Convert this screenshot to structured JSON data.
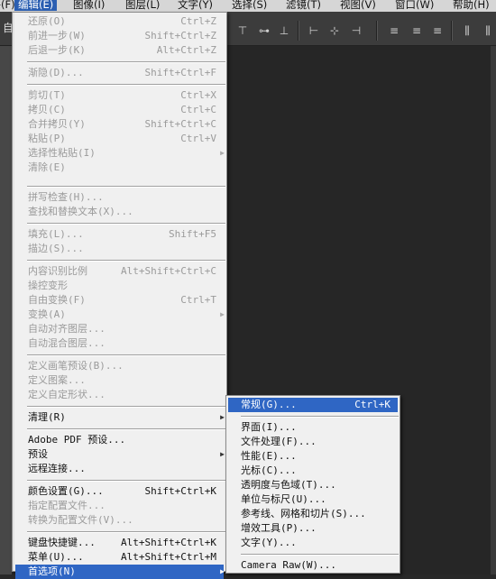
{
  "menubar": {
    "items": [
      "文件(F)",
      "编辑(E)",
      "图像(I)",
      "图层(L)",
      "文字(Y)",
      "选择(S)",
      "滤镜(T)",
      "视图(V)",
      "窗口(W)",
      "帮助(H)"
    ],
    "active_index": 1
  },
  "optbar": {
    "stub_label": "自"
  },
  "edit_menu": {
    "items": [
      {
        "label": "还原(O)",
        "shortcut": "Ctrl+Z",
        "enabled": false
      },
      {
        "label": "前进一步(W)",
        "shortcut": "Shift+Ctrl+Z",
        "enabled": false
      },
      {
        "label": "后退一步(K)",
        "shortcut": "Alt+Ctrl+Z",
        "enabled": false
      },
      {
        "label": "渐隐(D)...",
        "shortcut": "Shift+Ctrl+F",
        "enabled": false
      },
      {
        "label": "剪切(T)",
        "shortcut": "Ctrl+X",
        "enabled": false
      },
      {
        "label": "拷贝(C)",
        "shortcut": "Ctrl+C",
        "enabled": false
      },
      {
        "label": "合并拷贝(Y)",
        "shortcut": "Shift+Ctrl+C",
        "enabled": false
      },
      {
        "label": "粘贴(P)",
        "shortcut": "Ctrl+V",
        "enabled": false
      },
      {
        "label": "选择性粘贴(I)",
        "shortcut": "",
        "enabled": false,
        "submenu": true
      },
      {
        "label": "清除(E)",
        "shortcut": "",
        "enabled": false
      },
      {
        "label": "拼写检查(H)...",
        "shortcut": "",
        "enabled": false
      },
      {
        "label": "查找和替换文本(X)...",
        "shortcut": "",
        "enabled": false
      },
      {
        "label": "填充(L)...",
        "shortcut": "Shift+F5",
        "enabled": false
      },
      {
        "label": "描边(S)...",
        "shortcut": "",
        "enabled": false
      },
      {
        "label": "内容识别比例",
        "shortcut": "Alt+Shift+Ctrl+C",
        "enabled": false
      },
      {
        "label": "操控变形",
        "shortcut": "",
        "enabled": false
      },
      {
        "label": "自由变换(F)",
        "shortcut": "Ctrl+T",
        "enabled": false
      },
      {
        "label": "变换(A)",
        "shortcut": "",
        "enabled": false,
        "submenu": true
      },
      {
        "label": "自动对齐图层...",
        "shortcut": "",
        "enabled": false
      },
      {
        "label": "自动混合图层...",
        "shortcut": "",
        "enabled": false
      },
      {
        "label": "定义画笔预设(B)...",
        "shortcut": "",
        "enabled": false
      },
      {
        "label": "定义图案...",
        "shortcut": "",
        "enabled": false
      },
      {
        "label": "定义自定形状...",
        "shortcut": "",
        "enabled": false
      },
      {
        "label": "清理(R)",
        "shortcut": "",
        "enabled": true,
        "submenu": true
      },
      {
        "label": "Adobe PDF 预设...",
        "shortcut": "",
        "enabled": true
      },
      {
        "label": "预设",
        "shortcut": "",
        "enabled": true,
        "submenu": true
      },
      {
        "label": "远程连接...",
        "shortcut": "",
        "enabled": true
      },
      {
        "label": "颜色设置(G)...",
        "shortcut": "Shift+Ctrl+K",
        "enabled": true
      },
      {
        "label": "指定配置文件...",
        "shortcut": "",
        "enabled": false
      },
      {
        "label": "转换为配置文件(V)...",
        "shortcut": "",
        "enabled": false
      },
      {
        "label": "键盘快捷键...",
        "shortcut": "Alt+Shift+Ctrl+K",
        "enabled": true
      },
      {
        "label": "菜单(U)...",
        "shortcut": "Alt+Shift+Ctrl+M",
        "enabled": true
      },
      {
        "label": "首选项(N)",
        "shortcut": "",
        "enabled": true,
        "submenu": true,
        "highlighted": true
      }
    ]
  },
  "preferences_submenu": {
    "items": [
      {
        "label": "常规(G)...",
        "shortcut": "Ctrl+K",
        "highlighted": true
      },
      {
        "label": "界面(I)...",
        "shortcut": ""
      },
      {
        "label": "文件处理(F)...",
        "shortcut": ""
      },
      {
        "label": "性能(E)...",
        "shortcut": ""
      },
      {
        "label": "光标(C)...",
        "shortcut": ""
      },
      {
        "label": "透明度与色域(T)...",
        "shortcut": ""
      },
      {
        "label": "单位与标尺(U)...",
        "shortcut": ""
      },
      {
        "label": "参考线、网格和切片(S)...",
        "shortcut": ""
      },
      {
        "label": "增效工具(P)...",
        "shortcut": ""
      },
      {
        "label": "文字(Y)...",
        "shortcut": ""
      },
      {
        "label": "Camera Raw(W)...",
        "shortcut": ""
      }
    ]
  },
  "icons": {
    "submenu_arrow": "▶",
    "align_icons": [
      "align-top-icon",
      "align-vcenter-icon",
      "align-bottom-icon",
      "align-left-icon",
      "align-hcenter-icon",
      "align-right-icon",
      "distribute-top-icon",
      "distribute-vcenter-icon",
      "distribute-bottom-icon",
      "distribute-left-icon",
      "distribute-hcenter-icon"
    ]
  },
  "colors": {
    "highlight": "#2f66c4",
    "menu_bg": "#f0f0f0",
    "disabled_text": "#9a9a9a"
  }
}
